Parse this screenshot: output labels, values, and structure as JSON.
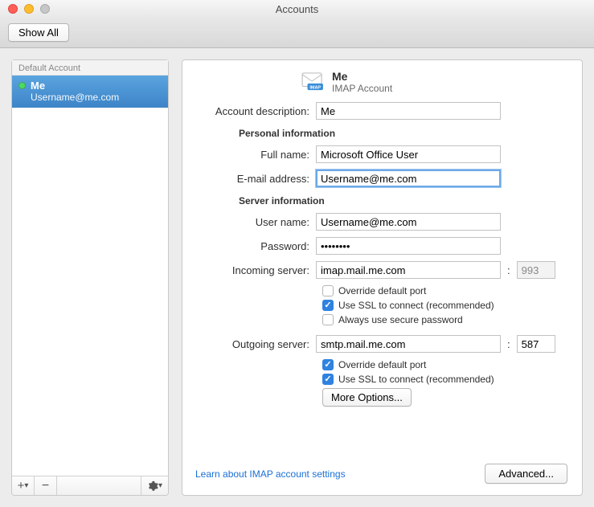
{
  "window": {
    "title": "Accounts"
  },
  "toolbar": {
    "show_all": "Show All"
  },
  "sidebar": {
    "header": "Default Account",
    "account": {
      "name": "Me",
      "email": "Username@me.com"
    },
    "add_tooltip": "+",
    "remove_tooltip": "−",
    "gear_tooltip": "⚙"
  },
  "header": {
    "name": "Me",
    "type": "IMAP Account",
    "imap_badge": "IMAP"
  },
  "labels": {
    "account_description": "Account description:",
    "personal_info": "Personal information",
    "full_name": "Full name:",
    "email": "E-mail address:",
    "server_info": "Server information",
    "user_name": "User name:",
    "password": "Password:",
    "incoming": "Incoming server:",
    "outgoing": "Outgoing server:",
    "override_port": "Override default port",
    "use_ssl": "Use SSL to connect (recommended)",
    "secure_pw": "Always use secure password",
    "more_options": "More Options...",
    "learn_link": "Learn about IMAP account settings",
    "advanced": "Advanced..."
  },
  "values": {
    "description": "Me",
    "full_name": "Microsoft Office User",
    "email": "Username@me.com",
    "user_name": "Username@me.com",
    "password": "••••••••",
    "incoming_server": "imap.mail.me.com",
    "incoming_port": "993",
    "outgoing_server": "smtp.mail.me.com",
    "outgoing_port": "587"
  },
  "checks": {
    "in_override": false,
    "in_ssl": true,
    "in_secure_pw": false,
    "out_override": true,
    "out_ssl": true
  }
}
